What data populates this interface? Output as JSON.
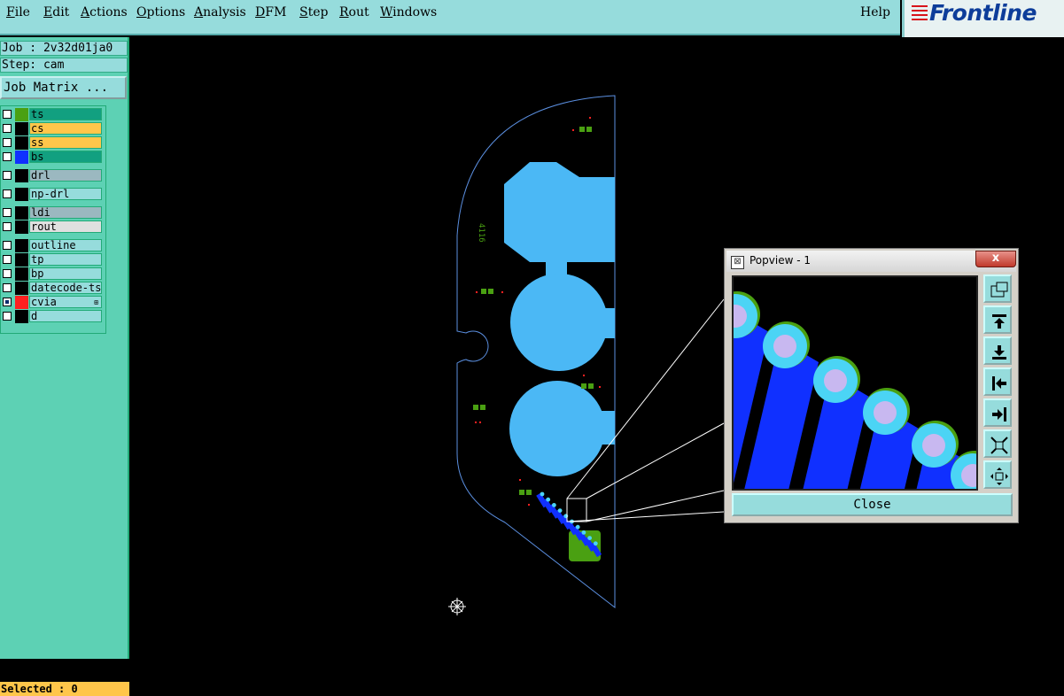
{
  "menu": {
    "file": "File",
    "edit": "Edit",
    "actions": "Actions",
    "options": "Options",
    "analysis": "Analysis",
    "dfm": "DFM",
    "step": "Step",
    "rout": "Rout",
    "windows": "Windows",
    "help": "Help"
  },
  "logo": {
    "text": "Frontline",
    "icon": "frontline-logo-icon",
    "colors": {
      "blue": "#0d3d9a",
      "red": "#d8131b"
    }
  },
  "job": {
    "label": "Job : 2v32d01ja0"
  },
  "step": {
    "label": "Step: cam"
  },
  "job_matrix_button": "Job Matrix ...",
  "layers": [
    {
      "name": "ts",
      "color": "#4aa012",
      "label_bg": "#12a080",
      "checked": false
    },
    {
      "name": "cs",
      "color": "#000000",
      "label_bg": "#ffc64a",
      "checked": false
    },
    {
      "name": "ss",
      "color": "#000000",
      "label_bg": "#ffc64a",
      "checked": false
    },
    {
      "name": "bs",
      "color": "#1030ff",
      "label_bg": "#12a080",
      "checked": false
    },
    {
      "name": "drl",
      "color": "#000000",
      "label_bg": "#9bb8c0",
      "checked": false
    },
    {
      "name": "np-drl",
      "color": "#000000",
      "label_bg": "#96dcdc",
      "checked": false
    },
    {
      "name": "ldi",
      "color": "#000000",
      "label_bg": "#9bb8c0",
      "checked": false
    },
    {
      "name": "rout",
      "color": "#000000",
      "label_bg": "#e0e0e0",
      "checked": false
    },
    {
      "name": "outline",
      "color": "#000000",
      "label_bg": "#96dcdc",
      "checked": false
    },
    {
      "name": "tp",
      "color": "#000000",
      "label_bg": "#96dcdc",
      "checked": false
    },
    {
      "name": "bp",
      "color": "#000000",
      "label_bg": "#96dcdc",
      "checked": false
    },
    {
      "name": "datecode-ts",
      "color": "#000000",
      "label_bg": "#96dcdc",
      "checked": false
    },
    {
      "name": "cvia",
      "color": "#ff2020",
      "label_bg": "#96dcdc",
      "checked": true,
      "extra": "⊞"
    },
    {
      "name": "d",
      "color": "#000000",
      "label_bg": "#96dcdc",
      "checked": false
    }
  ],
  "status": {
    "selected": "Selected : 0"
  },
  "board": {
    "silkscreen_text": "4116",
    "pad_color": "#4bb8f5",
    "outline_color": "#5b8fe0",
    "trace_color": "#1030ff"
  },
  "popview": {
    "title": "Popview - 1",
    "close_x": "x",
    "close_button": "Close",
    "tools": [
      "zoom-fit-icon",
      "pan-up-icon",
      "pan-down-icon",
      "pan-left-icon",
      "pan-right-icon",
      "zoom-in-icon",
      "zoom-out-icon"
    ]
  }
}
